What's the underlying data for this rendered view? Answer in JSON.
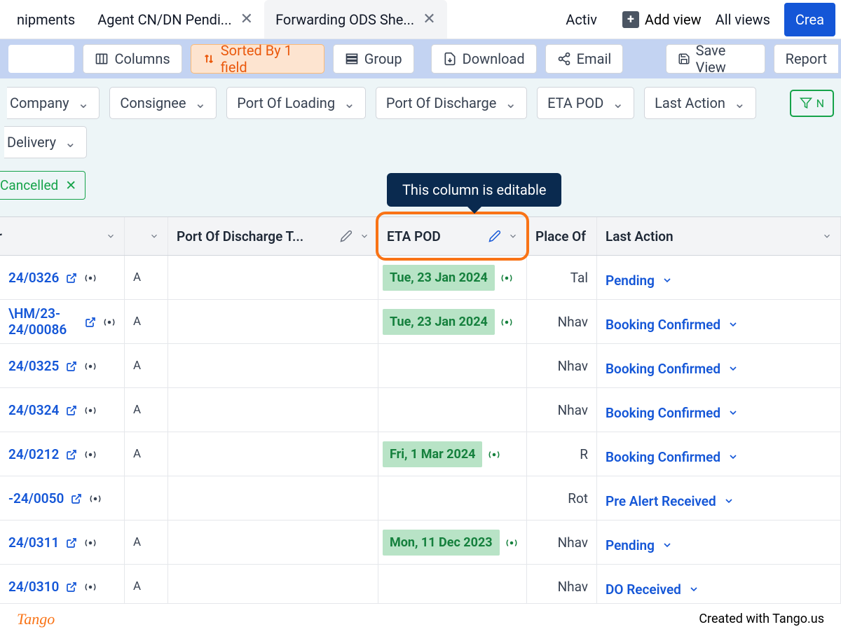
{
  "tabs": {
    "items": [
      {
        "label": "nipments"
      },
      {
        "label": "Agent CN/DN Pendi..."
      },
      {
        "label": "Forwarding ODS She..."
      },
      {
        "label": "Activ"
      }
    ],
    "add_view": "Add view",
    "all_views": "All views",
    "create": "Crea"
  },
  "toolbar": {
    "columns": "Columns",
    "sorted": "Sorted By 1 field",
    "group": "Group",
    "download": "Download",
    "email": "Email",
    "save_view": "Save View",
    "report": "Report"
  },
  "filters": {
    "company": "Company",
    "consignee": "Consignee",
    "pol": "Port Of Loading",
    "pod": "Port Of Discharge",
    "eta_pod": "ETA POD",
    "last_action": "Last Action",
    "delivery": "Delivery",
    "filter_btn": "N"
  },
  "cancelled": "Cancelled",
  "tooltip": "This column is editable",
  "columns": {
    "er": "r",
    "pod_terminal": "Port Of Discharge T...",
    "eta_pod": "ETA POD",
    "place_of": "Place Of",
    "last_action": "Last Action"
  },
  "rows": [
    {
      "id": "24/0326",
      "sig": "A",
      "eta": "Tue, 23 Jan 2024",
      "has_eta": true,
      "place": "Tal",
      "action": "Pending"
    },
    {
      "id": "\\HM/23-24/00086",
      "sig": "A",
      "eta": "Tue, 23 Jan 2024",
      "has_eta": true,
      "place": "Nhav",
      "action": "Booking Confirmed"
    },
    {
      "id": "24/0325",
      "sig": "A",
      "eta": "",
      "has_eta": false,
      "place": "Nhav",
      "action": "Booking Confirmed"
    },
    {
      "id": "24/0324",
      "sig": "A",
      "eta": "",
      "has_eta": false,
      "place": "Nhav",
      "action": "Booking Confirmed"
    },
    {
      "id": "24/0212",
      "sig": "A",
      "eta": "Fri, 1 Mar 2024",
      "has_eta": true,
      "place": "R",
      "action": "Booking Confirmed"
    },
    {
      "id": "-24/0050",
      "sig": "",
      "eta": "",
      "has_eta": false,
      "place": "Rot",
      "action": "Pre Alert Received"
    },
    {
      "id": "24/0311",
      "sig": "A",
      "eta": "Mon, 11 Dec 2023",
      "has_eta": true,
      "place": "Nhav",
      "action": "Pending"
    },
    {
      "id": "24/0310",
      "sig": "A",
      "eta": "",
      "has_eta": false,
      "place": "Nhav",
      "action": "DO Received"
    }
  ],
  "footer": {
    "logo": "Tango",
    "credit": "Created with Tango.us"
  }
}
